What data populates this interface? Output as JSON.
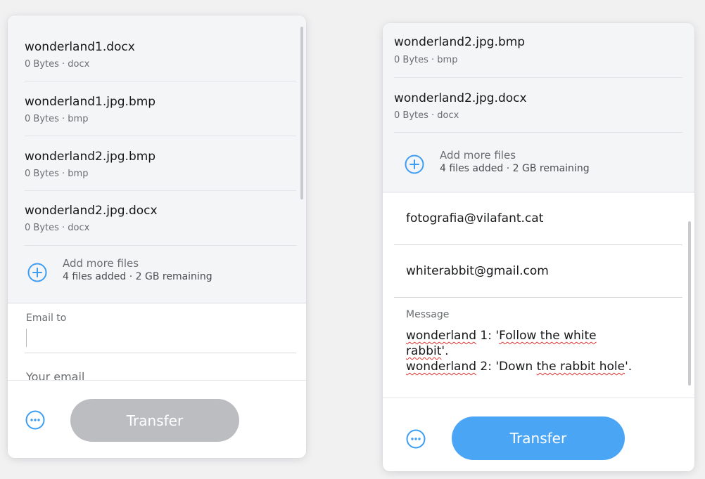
{
  "left_panel": {
    "files": [
      {
        "name": "wonderland1.docx",
        "meta": "0 Bytes · docx"
      },
      {
        "name": "wonderland1.jpg.bmp",
        "meta": "0 Bytes · bmp"
      },
      {
        "name": "wonderland2.jpg.bmp",
        "meta": "0 Bytes · bmp"
      },
      {
        "name": "wonderland2.jpg.docx",
        "meta": "0 Bytes · docx"
      }
    ],
    "add_more": {
      "title": "Add more files",
      "subtitle": "4 files added · 2 GB remaining"
    },
    "email_to_label": "Email to",
    "email_to_value": "",
    "your_email_label": "Your email",
    "transfer_label": "Transfer",
    "transfer_enabled": false
  },
  "right_panel": {
    "files": [
      {
        "name": "wonderland2.jpg.bmp",
        "meta": "0 Bytes · bmp"
      },
      {
        "name": "wonderland2.jpg.docx",
        "meta": "0 Bytes · docx"
      }
    ],
    "add_more": {
      "title": "Add more files",
      "subtitle": "4 files added · 2 GB remaining"
    },
    "recipient_email": "fotografia@vilafant.cat",
    "sender_email": "whiterabbit@gmail.com",
    "message_label": "Message",
    "message": {
      "line1_a": "wonderland",
      "line1_b": " 1: '",
      "line1_c": "Follow the white",
      "line2_a": "rabbit",
      "line2_b": "'.",
      "line3_a": "wonderland",
      "line3_b": " 2: 'Down ",
      "line3_c": "the rabbit hole",
      "line3_d": "'."
    },
    "transfer_label": "Transfer",
    "transfer_enabled": true
  },
  "colors": {
    "accent": "#3d9df3",
    "transfer_active": "#4aa6f5",
    "transfer_disabled": "#bcbdc0",
    "file_area_bg": "#f4f5f7",
    "spellcheck_underline": "#e0322f"
  },
  "icons": {
    "add": "plus-circle-icon",
    "more": "ellipsis-circle-icon"
  }
}
